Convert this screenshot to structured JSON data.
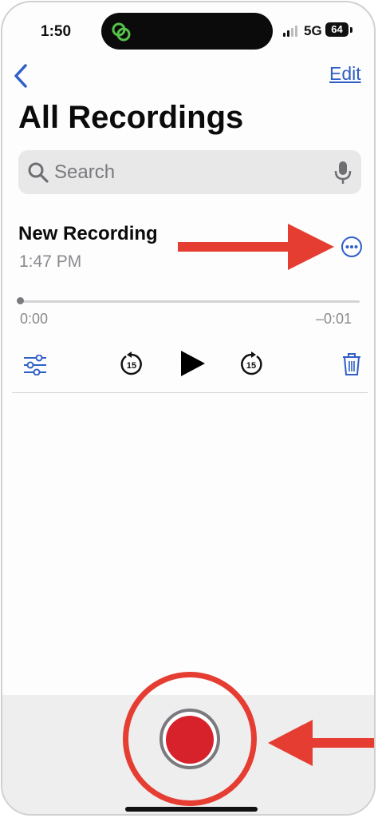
{
  "status_bar": {
    "time": "1:50",
    "network": "5G",
    "battery": "64"
  },
  "nav": {
    "edit_label": "Edit"
  },
  "page": {
    "title": "All Recordings"
  },
  "search": {
    "placeholder": "Search"
  },
  "recording": {
    "name": "New Recording",
    "time": "1:47 PM",
    "elapsed": "0:00",
    "remaining": "–0:01",
    "progress_fraction": 0
  },
  "controls": {
    "skip_back_seconds": "15",
    "skip_forward_seconds": "15"
  },
  "icons": [
    "back-chevron-icon",
    "search-icon",
    "microphone-icon",
    "more-options-icon",
    "edit-sliders-icon",
    "skip-back-15-icon",
    "play-icon",
    "skip-forward-15-icon",
    "trash-icon",
    "record-icon"
  ],
  "colors": {
    "accent": "#2f5fc7",
    "record": "#d7222c",
    "annotation": "#e53d32"
  }
}
